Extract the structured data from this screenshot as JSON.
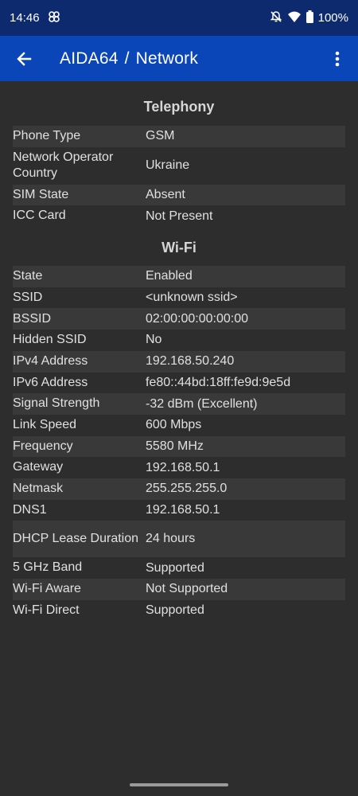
{
  "status": {
    "time": "14:46",
    "battery": "100%",
    "icons": [
      "pinwheel-icon",
      "bell-off-icon",
      "wifi-icon",
      "battery-icon"
    ]
  },
  "appbar": {
    "app": "AIDA64",
    "separator": "/",
    "page": "Network",
    "icons": [
      "back-arrow-icon",
      "more-vert-icon"
    ]
  },
  "telephony": {
    "title": "Telephony",
    "rows": [
      {
        "key": "Phone Type",
        "value": "GSM"
      },
      {
        "key": "Network Operator Country",
        "value": "Ukraine"
      },
      {
        "key": "SIM State",
        "value": "Absent"
      },
      {
        "key": "ICC Card",
        "value": "Not Present"
      }
    ]
  },
  "wifi": {
    "title": "Wi-Fi",
    "rows": [
      {
        "key": "State",
        "value": "Enabled"
      },
      {
        "key": "SSID",
        "value": "<unknown ssid>"
      },
      {
        "key": "BSSID",
        "value": "02:00:00:00:00:00"
      },
      {
        "key": "Hidden SSID",
        "value": "No"
      },
      {
        "key": "IPv4 Address",
        "value": "192.168.50.240"
      },
      {
        "key": "IPv6 Address",
        "value": "fe80::44bd:18ff:fe9d:9e5d"
      },
      {
        "key": "Signal Strength",
        "value": "-32 dBm (Excellent)"
      },
      {
        "key": "Link Speed",
        "value": "600 Mbps"
      },
      {
        "key": "Frequency",
        "value": "5580 MHz"
      },
      {
        "key": "Gateway",
        "value": "192.168.50.1"
      },
      {
        "key": "Netmask",
        "value": "255.255.255.0"
      },
      {
        "key": "DNS1",
        "value": "192.168.50.1"
      },
      {
        "key": "DHCP Lease Duration",
        "value": "24 hours"
      },
      {
        "key": "5 GHz Band",
        "value": "Supported"
      },
      {
        "key": "Wi-Fi Aware",
        "value": "Not Supported"
      },
      {
        "key": "Wi-Fi Direct",
        "value": "Supported"
      }
    ]
  }
}
